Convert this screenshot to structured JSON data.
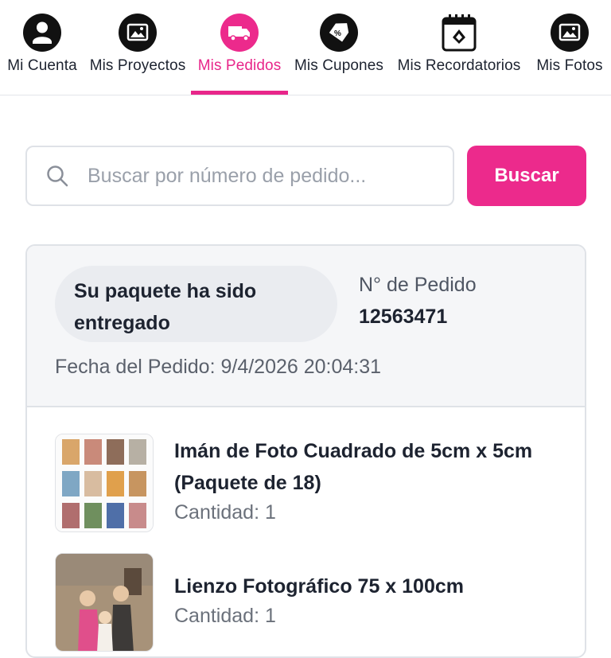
{
  "nav": {
    "items": [
      {
        "label": "Mi Cuenta",
        "icon": "user-icon"
      },
      {
        "label": "Mis Proyectos",
        "icon": "image-icon"
      },
      {
        "label": "Mis Pedidos",
        "icon": "truck-icon",
        "active": true
      },
      {
        "label": "Mis Cupones",
        "icon": "coupon-tag-icon"
      },
      {
        "label": "Mis Recordatorios",
        "icon": "calendar-icon"
      },
      {
        "label": "Mis Fotos",
        "icon": "image-icon"
      }
    ]
  },
  "search": {
    "placeholder": "Buscar por número de pedido...",
    "value": "",
    "button_label": "Buscar"
  },
  "order": {
    "status": "Su paquete ha sido entregado",
    "number_label": "N° de Pedido",
    "number": "12563471",
    "date_text": "Fecha del Pedido: 9/4/2026 20:04:31",
    "products": [
      {
        "title_line1": "Imán de Foto Cuadrado de 5cm x 5cm",
        "title_line2": "(Paquete de 18)",
        "quantity": "Cantidad: 1"
      },
      {
        "title_line1": "Lienzo Fotográfico 75 x 100cm",
        "quantity": "Cantidad: 1"
      }
    ]
  },
  "colors": {
    "accent": "#e8268a",
    "button": "#ec2a8c",
    "text": "#1d2330",
    "muted": "#9aa0aa",
    "border": "#dfe2e7"
  }
}
